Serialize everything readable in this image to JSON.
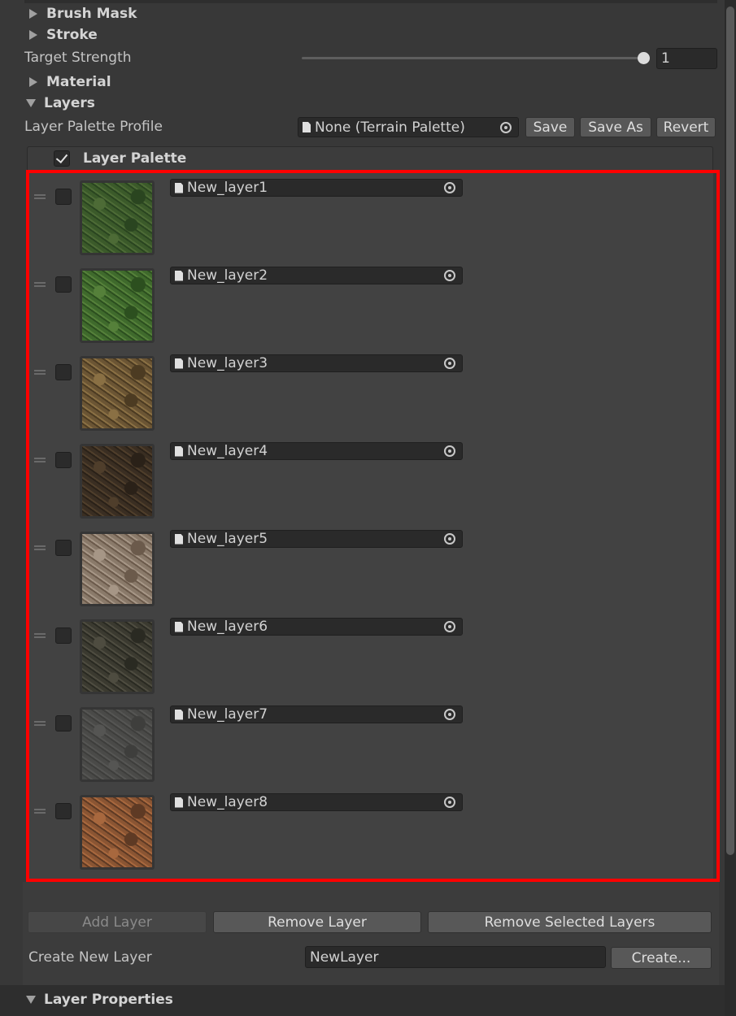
{
  "sections": {
    "brush_mask": "Brush Mask",
    "stroke": "Stroke",
    "material": "Material",
    "layers": "Layers",
    "layer_properties": "Layer Properties"
  },
  "target_strength": {
    "label": "Target Strength",
    "value": "1",
    "fraction": 1.0
  },
  "profile": {
    "label": "Layer Palette Profile",
    "value": "None (Terrain Palette)",
    "save": "Save",
    "save_as": "Save As",
    "revert": "Revert"
  },
  "palette": {
    "title": "Layer Palette",
    "enabled": true,
    "layers": [
      {
        "name": "New_layer1",
        "texture": "grass",
        "colors": [
          "#3b5a2a",
          "#2a4520",
          "#4d6b36"
        ]
      },
      {
        "name": "New_layer2",
        "texture": "grass",
        "colors": [
          "#3f6a2c",
          "#2c4f1f",
          "#55803a"
        ]
      },
      {
        "name": "New_layer3",
        "texture": "dirt-leaves",
        "colors": [
          "#6b5534",
          "#4c3b22",
          "#8a7044"
        ]
      },
      {
        "name": "New_layer4",
        "texture": "forest-floor",
        "colors": [
          "#3a2e22",
          "#2a2118",
          "#4f3e2b"
        ]
      },
      {
        "name": "New_layer5",
        "texture": "gravel-leaves",
        "colors": [
          "#8a7a6a",
          "#6b5a4b",
          "#a69686"
        ]
      },
      {
        "name": "New_layer6",
        "texture": "roots",
        "colors": [
          "#3b3a30",
          "#2a2a22",
          "#4e4c40"
        ]
      },
      {
        "name": "New_layer7",
        "texture": "concrete",
        "colors": [
          "#4a4a48",
          "#3e3e3c",
          "#555553"
        ]
      },
      {
        "name": "New_layer8",
        "texture": "autumn-dirt",
        "colors": [
          "#8a5533",
          "#5e3a24",
          "#a8683e"
        ]
      }
    ]
  },
  "actions": {
    "add_layer": "Add Layer",
    "remove_layer": "Remove Layer",
    "remove_selected": "Remove Selected Layers"
  },
  "create": {
    "label": "Create New Layer",
    "value": "NewLayer",
    "button": "Create..."
  },
  "icons": {
    "foldout_collapsed": "triangle-right-icon",
    "foldout_expanded": "triangle-down-icon",
    "object_picker": "object-picker-icon",
    "document": "document-icon",
    "drag_handle": "drag-handle-icon",
    "check": "checkmark-icon"
  },
  "colors": {
    "highlight_frame": "#ff0000",
    "panel": "#383838",
    "list": "#424242"
  }
}
